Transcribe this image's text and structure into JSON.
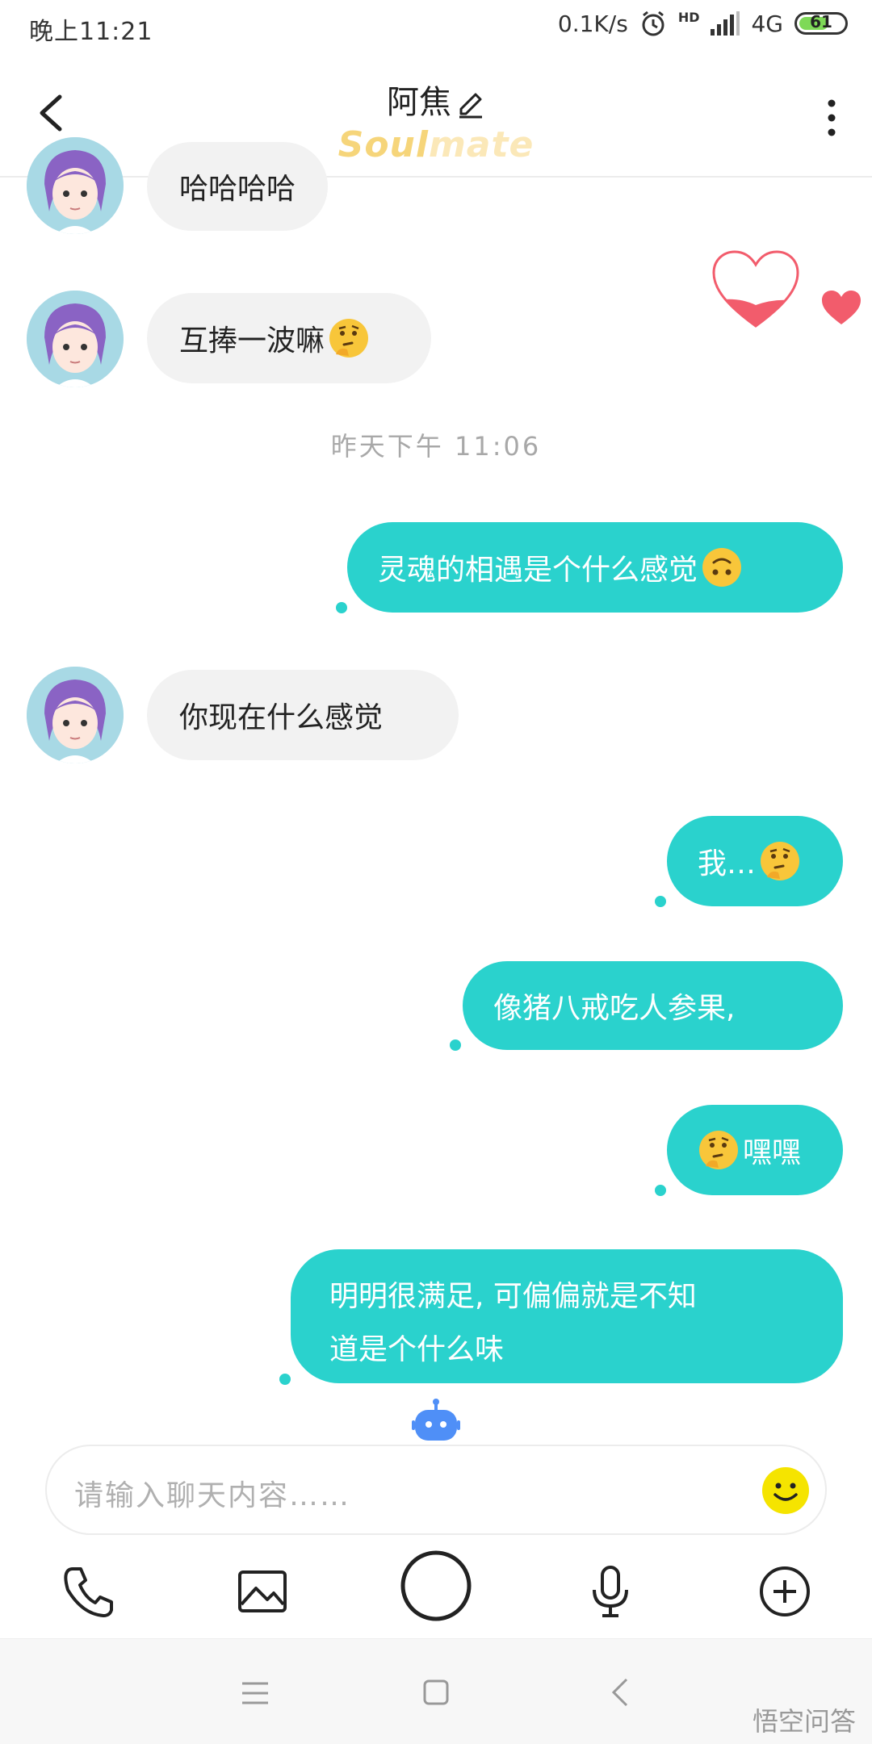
{
  "status_bar": {
    "time": "晚上11:21",
    "net_speed": "0.1K/s",
    "signal_label": "4G",
    "hd_label": "HD",
    "battery_level": "61"
  },
  "header": {
    "title": "阿焦",
    "subtitle_a": "Soul",
    "subtitle_b": "mate"
  },
  "messages": {
    "m1": "哈哈哈哈",
    "m2": "互捧一波嘛",
    "timestamp": "昨天下午 11:06",
    "m3": "灵魂的相遇是个什么感觉",
    "m4": "你现在什么感觉",
    "m5": "我…",
    "m6": "像猪八戒吃人参果,",
    "m7": "嘿嘿",
    "m8_line1": "明明很满足, 可偏偏就是不知",
    "m8_line2": "道是个什么味"
  },
  "input": {
    "placeholder": "请输入聊天内容……"
  },
  "watermark": "悟空问答",
  "icons": {
    "emoji_thinking": "thinking-face-icon",
    "emoji_upside_down": "upside-down-face-icon",
    "heart": "heart-icon"
  },
  "colors": {
    "bubble_out": "#2ad2cd",
    "bubble_in": "#f2f2f2",
    "brand_gold": "#f6d57a",
    "heart_red": "#f25c6c"
  }
}
